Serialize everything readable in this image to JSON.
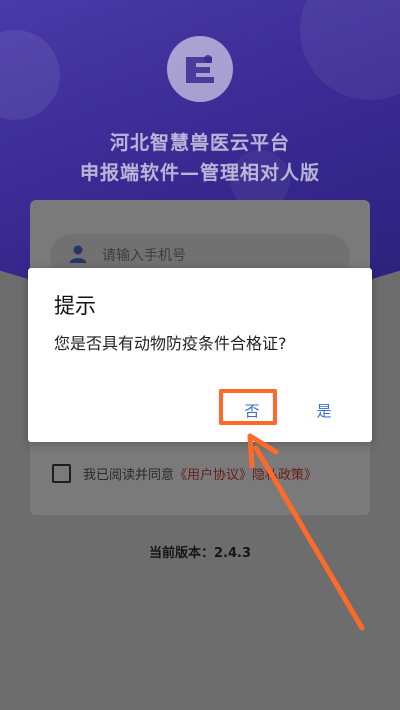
{
  "app": {
    "title_line1": "河北智慧兽医云平台",
    "title_line2": "申报端软件—管理相对人版"
  },
  "login": {
    "phone_placeholder": "请输入手机号"
  },
  "agreement": {
    "prefix": "我已阅读并同意",
    "link": "《用户协议》隐私政策》"
  },
  "version": {
    "text": "当前版本：2.4.3"
  },
  "dialog": {
    "title": "提示",
    "message": "您是否具有动物防疫条件合格证?",
    "no_label": "否",
    "yes_label": "是"
  },
  "colors": {
    "header_gradient_start": "#4a3aa8",
    "header_gradient_end": "#2a1f78",
    "dialog_button": "#3a6cd6",
    "annotation": "#ff6a2a",
    "dim_overlay": "#6d6d6d"
  },
  "icons": {
    "logo": "logo-icon",
    "user": "user-icon",
    "annotation_arrow": "arrow-annotation"
  }
}
